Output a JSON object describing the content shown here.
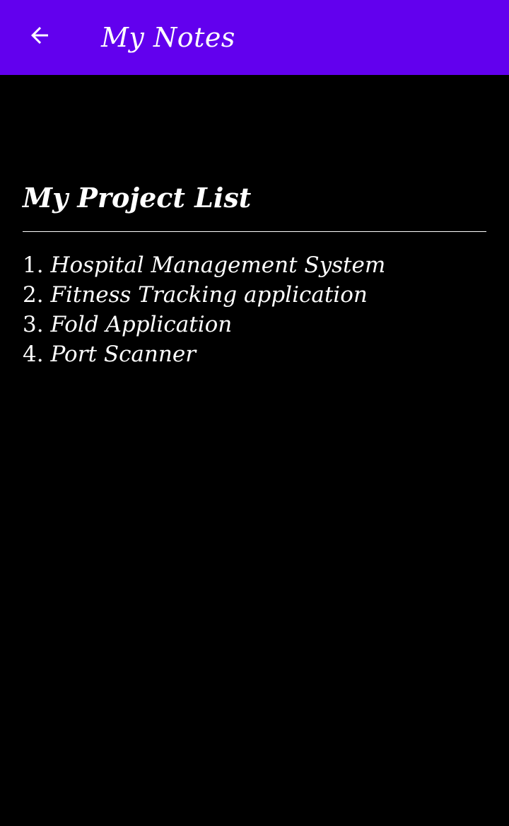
{
  "colors": {
    "app_bar": "#6200ee",
    "background": "#000000",
    "text": "#ffffff"
  },
  "app_bar": {
    "back_icon": "arrow-back-icon",
    "title": "My Notes"
  },
  "note": {
    "heading": "My Project List",
    "items": [
      {
        "number": "1.",
        "text": "Hospital Management System"
      },
      {
        "number": "2.",
        "text": "Fitness Tracking application"
      },
      {
        "number": "3.",
        "text": "Fold Application"
      },
      {
        "number": "4.",
        "text": "Port Scanner"
      }
    ]
  }
}
